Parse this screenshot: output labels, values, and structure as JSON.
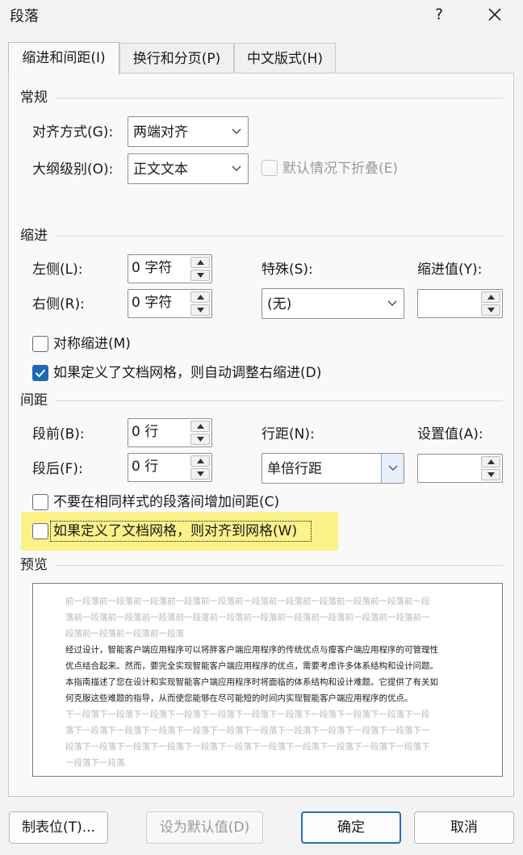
{
  "window": {
    "title": "段落",
    "help": "?"
  },
  "tabs": [
    {
      "label": "缩进和间距(I)",
      "active": true
    },
    {
      "label": "换行和分页(P)",
      "active": false
    },
    {
      "label": "中文版式(H)",
      "active": false
    }
  ],
  "general": {
    "heading": "常规",
    "alignment_label": "对齐方式(G):",
    "alignment_value": "两端对齐",
    "outline_label": "大纲级别(O):",
    "outline_value": "正文文本",
    "collapse_label": "默认情况下折叠(E)"
  },
  "indent": {
    "heading": "缩进",
    "left_label": "左侧(L):",
    "left_value": "0 字符",
    "right_label": "右侧(R):",
    "right_value": "0 字符",
    "special_label": "特殊(S):",
    "special_value": "(无)",
    "indent_value_label": "缩进值(Y):",
    "indent_value": "",
    "mirror_label": "对称缩进(M)",
    "mirror_checked": false,
    "auto_adjust_label": "如果定义了文档网格，则自动调整右缩进(D)",
    "auto_adjust_checked": true
  },
  "spacing": {
    "heading": "间距",
    "before_label": "段前(B):",
    "before_value": "0 行",
    "after_label": "段后(F):",
    "after_value": "0 行",
    "line_label": "行距(N):",
    "line_value": "单倍行距",
    "at_label": "设置值(A):",
    "at_value": "",
    "no_space_same_style_label": "不要在相同样式的段落间增加间距(C)",
    "no_space_same_style_checked": false,
    "snap_to_grid_label": "如果定义了文档网格，则对齐到网格(W)",
    "snap_to_grid_checked": false
  },
  "preview": {
    "heading": "预览",
    "prev_lines": [
      "前一段落前一段落前一段落前一段落前一段落前一段落前一段落前一段落前一段落前一段落前一段",
      "落前一段落前一段落前一段落前一段落前一段落前一段落前一段落前一段落前一段落前一段落前一",
      "段落前一段落前一段落前一段落"
    ],
    "body_lines": [
      "经过设计，智能客户端应用程序可以将胖客户端应用程序的传统优点与瘦客户端应用程序的可管理性",
      "优点结合起来。然而，要完全实现智能客户端应用程序的优点，需要考虑许多体系结构和设计问题。",
      "本指南描述了您在设计和实现智能客户端应用程序时将面临的体系结构和设计难题。它提供了有关如",
      "何克服这些难题的指导，从而使您能够在尽可能短的时间内实现智能客户端应用程序的优点。"
    ],
    "next_lines": [
      "下一段落下一段落下一段落下一段落下一段落下一段落下一段落下一段落下一段落下一段落下一段",
      "落下一段落下一段落下一段落下一段落下一段落下一段落下一段落下一段落下一段落下一段落下一",
      "段落下一段落下一段落下一段落下一段落下一段落下一段落下一段落下一段落下一段落下一段落下",
      "一段落下一段落"
    ]
  },
  "buttons": {
    "tabs": "制表位(T)...",
    "set_default": "设为默认值(D)",
    "ok": "确定",
    "cancel": "取消"
  },
  "colors": {
    "checkbox_accent": "#1f66b8",
    "highlight": "#fbf28a"
  }
}
